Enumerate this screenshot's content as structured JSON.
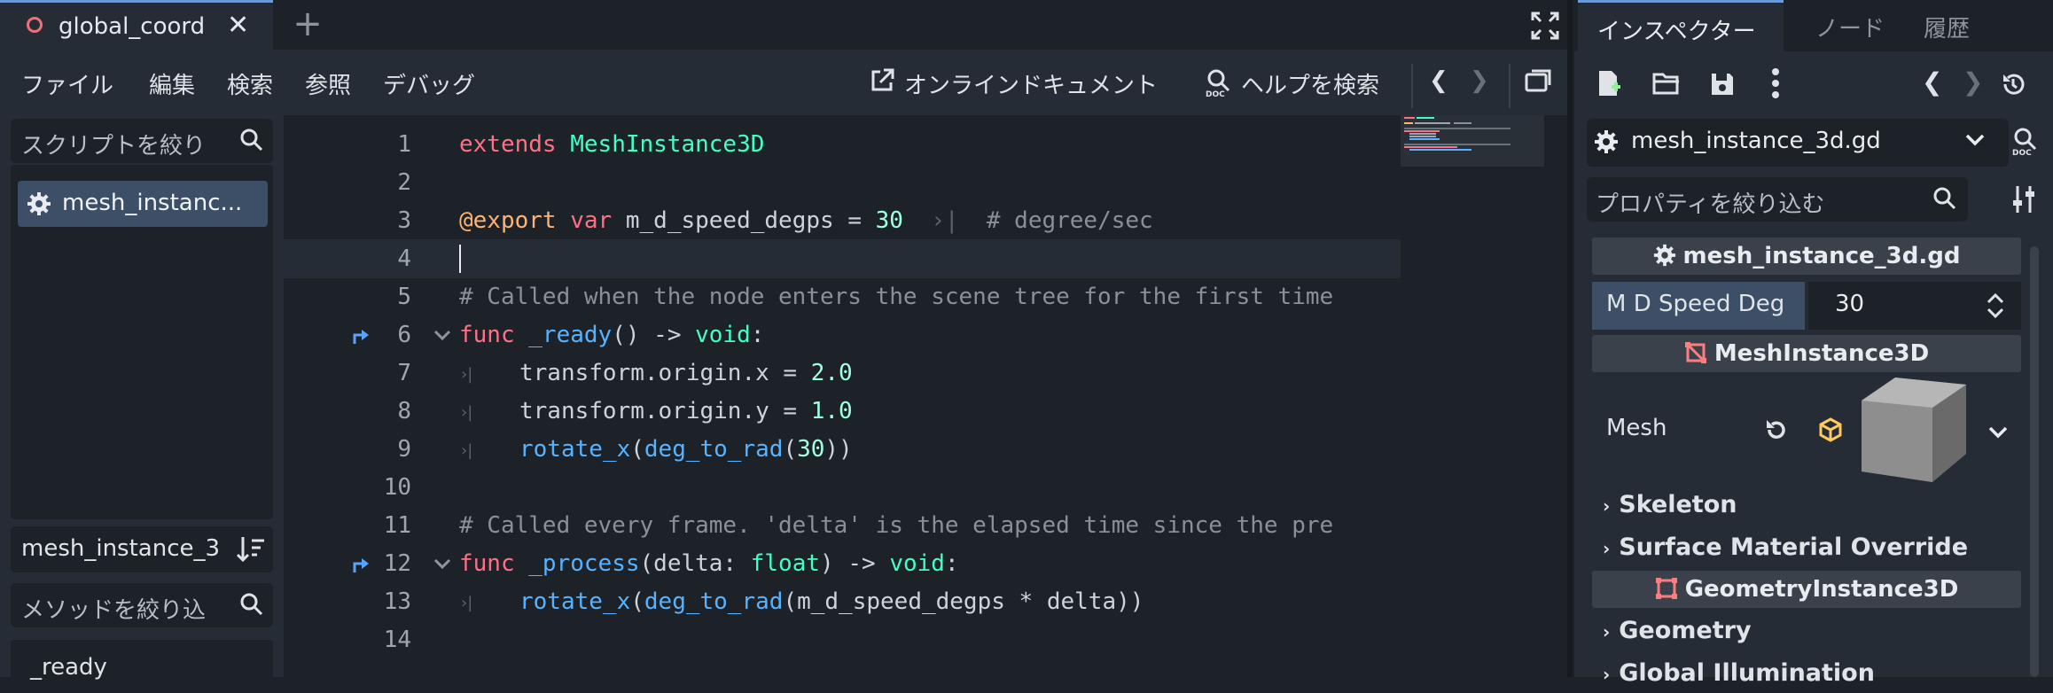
{
  "editor": {
    "tab_title": "global_coord",
    "tab_close": "✕",
    "tab_add": "+",
    "menu": [
      "ファイル",
      "編集",
      "検索",
      "参照",
      "デバッグ"
    ],
    "online_docs": "オンラインドキュメント",
    "search_help": "ヘルプを検索",
    "nav_back": "❮",
    "nav_forward": "❯"
  },
  "left_panel": {
    "script_filter_placeholder": "スクリプトを絞り",
    "script_item": "mesh_instanc...",
    "current_script": "mesh_instance_3",
    "method_filter_placeholder": "メソッドを絞り込",
    "method_item": "_ready"
  },
  "code": {
    "line_numbers": [
      "1",
      "2",
      "3",
      "4",
      "5",
      "6",
      "7",
      "8",
      "9",
      "10",
      "11",
      "12",
      "13",
      "14"
    ],
    "l1_kw": "extends",
    "l1_ty": "MeshInstance3D",
    "l3_ann": "@export",
    "l3_kw": "var",
    "l3_name": "m_d_speed_degps = ",
    "l3_num": "30",
    "l3_comment": "# degree/sec",
    "l5_comment": "# Called when the node enters the scene tree for the first time",
    "l6_kw": "func",
    "l6_fn": "_ready",
    "l6_rest": "() -> ",
    "l6_ty": "void",
    "l6_colon": ":",
    "l7": "transform.origin.x = ",
    "l7_num": "2.0",
    "l8": "transform.origin.y = ",
    "l8_num": "1.0",
    "l9_fn1": "rotate_x",
    "l9_p1": "(",
    "l9_fn2": "deg_to_rad",
    "l9_p2": "(",
    "l9_num": "30",
    "l9_p3": "))",
    "l11_comment": "# Called every frame. 'delta' is the elapsed time since the pre",
    "l12_kw": "func",
    "l12_fn": "_process",
    "l12_a": "(delta: ",
    "l12_ty1": "float",
    "l12_b": ") -> ",
    "l12_ty2": "void",
    "l12_colon": ":",
    "l13_fn1": "rotate_x",
    "l13_p1": "(",
    "l13_fn2": "deg_to_rad",
    "l13_rest": "(m_d_speed_degps * delta))"
  },
  "inspector": {
    "tabs": [
      "インスペクター",
      "ノード",
      "履歴"
    ],
    "resource": "mesh_instance_3d.gd",
    "property_filter_placeholder": "プロパティを絞り込む",
    "script_section": "mesh_instance_3d.gd",
    "prop_name": "M D Speed Deg",
    "prop_value": "30",
    "mesh_section": "MeshInstance3D",
    "mesh_label": "Mesh",
    "groups": [
      "Skeleton",
      "Surface Material Override"
    ],
    "geom_section": "GeometryInstance3D",
    "groups2": [
      "Geometry",
      "Global Illumination"
    ]
  },
  "colors": {
    "accent": "#6a9ad8",
    "keyword": "#ff7085",
    "type": "#42ffc2",
    "function": "#57b3ff",
    "comment": "#8a9098",
    "number": "#a1ffe0",
    "selection": "#3c4f66",
    "mesh_icon": "#fc7f7f"
  }
}
